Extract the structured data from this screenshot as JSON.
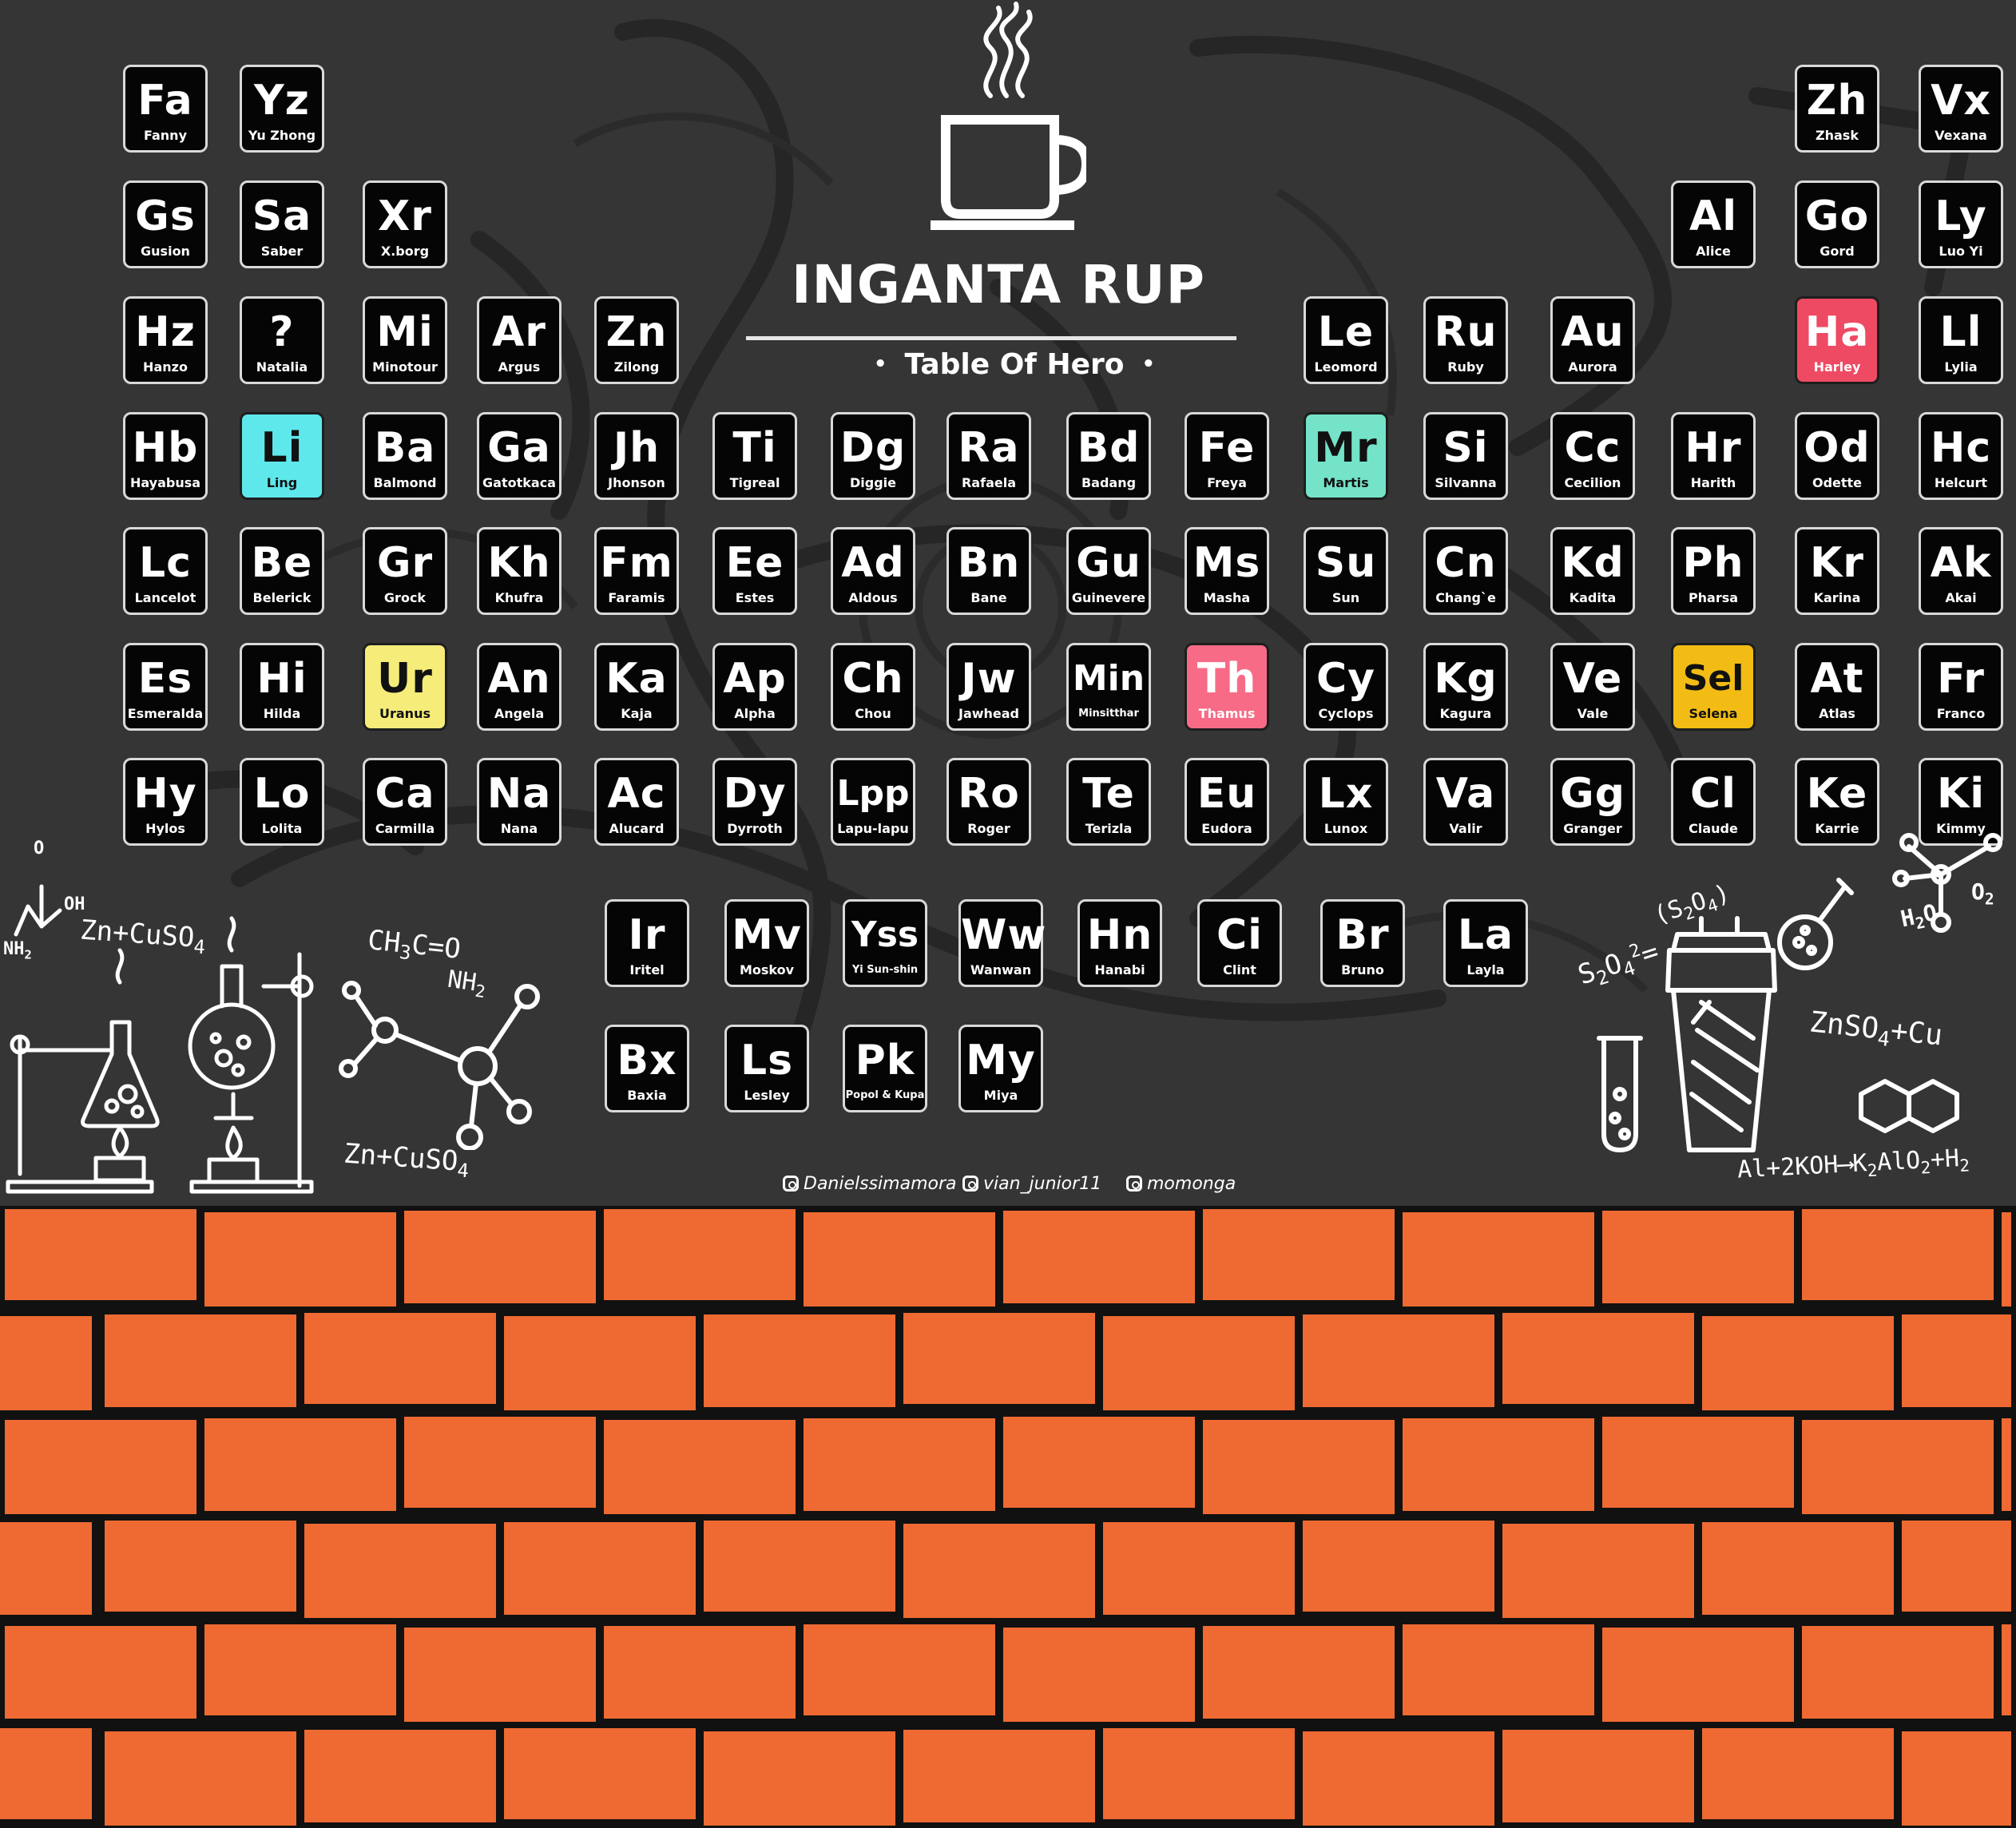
{
  "header": {
    "title": "INGANTA RUP",
    "subtitle": "Table Of Hero",
    "subtitle_dot": "•"
  },
  "colors": {
    "board": "#353535",
    "tile_bg": "#050505",
    "tile_border": "#d9d9d9",
    "brick": "#ee6a32",
    "mortar": "#111111",
    "highlight_cyan": "#5fe8ec",
    "highlight_mint": "#74e3c8",
    "highlight_red": "#ef4a63",
    "highlight_pink": "#f76b86",
    "highlight_yellow": "#f5ec7a",
    "highlight_gold": "#f2bc14"
  },
  "tiles": [
    {
      "symbol": "Fa",
      "name": "Fanny"
    },
    {
      "symbol": "Yz",
      "name": "Yu Zhong"
    },
    {
      "symbol": "Zh",
      "name": "Zhask"
    },
    {
      "symbol": "Vx",
      "name": "Vexana"
    },
    {
      "symbol": "Gs",
      "name": "Gusion"
    },
    {
      "symbol": "Sa",
      "name": "Saber"
    },
    {
      "symbol": "Xr",
      "name": "X.borg"
    },
    {
      "symbol": "Al",
      "name": "Alice"
    },
    {
      "symbol": "Go",
      "name": "Gord"
    },
    {
      "symbol": "Ly",
      "name": "Luo Yi"
    },
    {
      "symbol": "Hz",
      "name": "Hanzo"
    },
    {
      "symbol": "?",
      "name": "Natalia"
    },
    {
      "symbol": "Mi",
      "name": "Minotour"
    },
    {
      "symbol": "Ar",
      "name": "Argus"
    },
    {
      "symbol": "Zn",
      "name": "Zilong"
    },
    {
      "symbol": "Le",
      "name": "Leomord"
    },
    {
      "symbol": "Ru",
      "name": "Ruby"
    },
    {
      "symbol": "Au",
      "name": "Aurora"
    },
    {
      "symbol": "Ha",
      "name": "Harley",
      "highlight": "red"
    },
    {
      "symbol": "Ll",
      "name": "Lylia"
    },
    {
      "symbol": "Hb",
      "name": "Hayabusa"
    },
    {
      "symbol": "Li",
      "name": "Ling",
      "highlight": "cyan"
    },
    {
      "symbol": "Ba",
      "name": "Balmond"
    },
    {
      "symbol": "Ga",
      "name": "Gatotkaca"
    },
    {
      "symbol": "Jh",
      "name": "Jhonson"
    },
    {
      "symbol": "Ti",
      "name": "Tigreal"
    },
    {
      "symbol": "Dg",
      "name": "Diggie"
    },
    {
      "symbol": "Ra",
      "name": "Rafaela"
    },
    {
      "symbol": "Bd",
      "name": "Badang"
    },
    {
      "symbol": "Fe",
      "name": "Freya"
    },
    {
      "symbol": "Mr",
      "name": "Martis",
      "highlight": "mint"
    },
    {
      "symbol": "Si",
      "name": "Silvanna"
    },
    {
      "symbol": "Cc",
      "name": "Cecilion"
    },
    {
      "symbol": "Hr",
      "name": "Harith"
    },
    {
      "symbol": "Od",
      "name": "Odette"
    },
    {
      "symbol": "Hc",
      "name": "Helcurt"
    },
    {
      "symbol": "Lc",
      "name": "Lancelot"
    },
    {
      "symbol": "Be",
      "name": "Belerick"
    },
    {
      "symbol": "Gr",
      "name": "Grock"
    },
    {
      "symbol": "Kh",
      "name": "Khufra"
    },
    {
      "symbol": "Fm",
      "name": "Faramis"
    },
    {
      "symbol": "Ee",
      "name": "Estes"
    },
    {
      "symbol": "Ad",
      "name": "Aldous"
    },
    {
      "symbol": "Bn",
      "name": "Bane"
    },
    {
      "symbol": "Gu",
      "name": "Guinevere"
    },
    {
      "symbol": "Ms",
      "name": "Masha"
    },
    {
      "symbol": "Su",
      "name": "Sun"
    },
    {
      "symbol": "Cn",
      "name": "Chang`e"
    },
    {
      "symbol": "Kd",
      "name": "Kadita"
    },
    {
      "symbol": "Ph",
      "name": "Pharsa"
    },
    {
      "symbol": "Kr",
      "name": "Karina"
    },
    {
      "symbol": "Ak",
      "name": "Akai"
    },
    {
      "symbol": "Es",
      "name": "Esmeralda"
    },
    {
      "symbol": "Hi",
      "name": "Hilda"
    },
    {
      "symbol": "Ur",
      "name": "Uranus",
      "highlight": "yellow"
    },
    {
      "symbol": "An",
      "name": "Angela"
    },
    {
      "symbol": "Ka",
      "name": "Kaja"
    },
    {
      "symbol": "Ap",
      "name": "Alpha"
    },
    {
      "symbol": "Ch",
      "name": "Chou"
    },
    {
      "symbol": "Jw",
      "name": "Jawhead"
    },
    {
      "symbol": "Min",
      "name": "Minsitthar"
    },
    {
      "symbol": "Th",
      "name": "Thamus",
      "highlight": "pink"
    },
    {
      "symbol": "Cy",
      "name": "Cyclops"
    },
    {
      "symbol": "Kg",
      "name": "Kagura"
    },
    {
      "symbol": "Ve",
      "name": "Vale"
    },
    {
      "symbol": "Sel",
      "name": "Selena",
      "highlight": "gold"
    },
    {
      "symbol": "At",
      "name": "Atlas"
    },
    {
      "symbol": "Fr",
      "name": "Franco"
    },
    {
      "symbol": "Hy",
      "name": "Hylos"
    },
    {
      "symbol": "Lo",
      "name": "Lolita"
    },
    {
      "symbol": "Ca",
      "name": "Carmilla"
    },
    {
      "symbol": "Na",
      "name": "Nana"
    },
    {
      "symbol": "Ac",
      "name": "Alucard"
    },
    {
      "symbol": "Dy",
      "name": "Dyrroth"
    },
    {
      "symbol": "Lpp",
      "name": "Lapu-lapu"
    },
    {
      "symbol": "Ro",
      "name": "Roger"
    },
    {
      "symbol": "Te",
      "name": "Terizla"
    },
    {
      "symbol": "Eu",
      "name": "Eudora"
    },
    {
      "symbol": "Lx",
      "name": "Lunox"
    },
    {
      "symbol": "Va",
      "name": "Valir"
    },
    {
      "symbol": "Gg",
      "name": "Granger"
    },
    {
      "symbol": "Cl",
      "name": "Claude"
    },
    {
      "symbol": "Ke",
      "name": "Karrie"
    },
    {
      "symbol": "Ki",
      "name": "Kimmy"
    },
    {
      "symbol": "Ir",
      "name": "Iritel"
    },
    {
      "symbol": "Mv",
      "name": "Moskov"
    },
    {
      "symbol": "Yss",
      "name": "Yi Sun-shin"
    },
    {
      "symbol": "Ww",
      "name": "Wanwan"
    },
    {
      "symbol": "Hn",
      "name": "Hanabi"
    },
    {
      "symbol": "Ci",
      "name": "Clint"
    },
    {
      "symbol": "Br",
      "name": "Bruno"
    },
    {
      "symbol": "La",
      "name": "Layla"
    },
    {
      "symbol": "Bx",
      "name": "Baxia"
    },
    {
      "symbol": "Ls",
      "name": "Lesley"
    },
    {
      "symbol": "Pk",
      "name": "Popol & Kupa"
    },
    {
      "symbol": "My",
      "name": "Miya"
    }
  ],
  "credits": [
    "Danielssimamora",
    "vian_junior11",
    "momonga"
  ],
  "formulas": {
    "oh": "OH",
    "o": "O",
    "nh2": "NH",
    "zn_cuso4_a": "Zn+CuSO",
    "ch3c_o": "CH",
    "ch3c_o_rest": "C=O",
    "nh2_b": "NH",
    "zn_cuso4_b": "Zn+CuSO",
    "s2o4": "S",
    "s2o4_b": "(S",
    "h2o": "H",
    "o2": "O",
    "znso4": "ZnSO",
    "znso4_rest": "+Cu",
    "al_koh": "Al+2KOH",
    "al_koh_rest": "K",
    "arrow": "⟶"
  },
  "icons": [
    "coffee-cup-icon",
    "instagram-icon",
    "flask-icon",
    "round-flask-icon",
    "burner-icon",
    "molecule-icon",
    "test-tube-icon",
    "shaker-icon",
    "naphthalene-icon"
  ]
}
